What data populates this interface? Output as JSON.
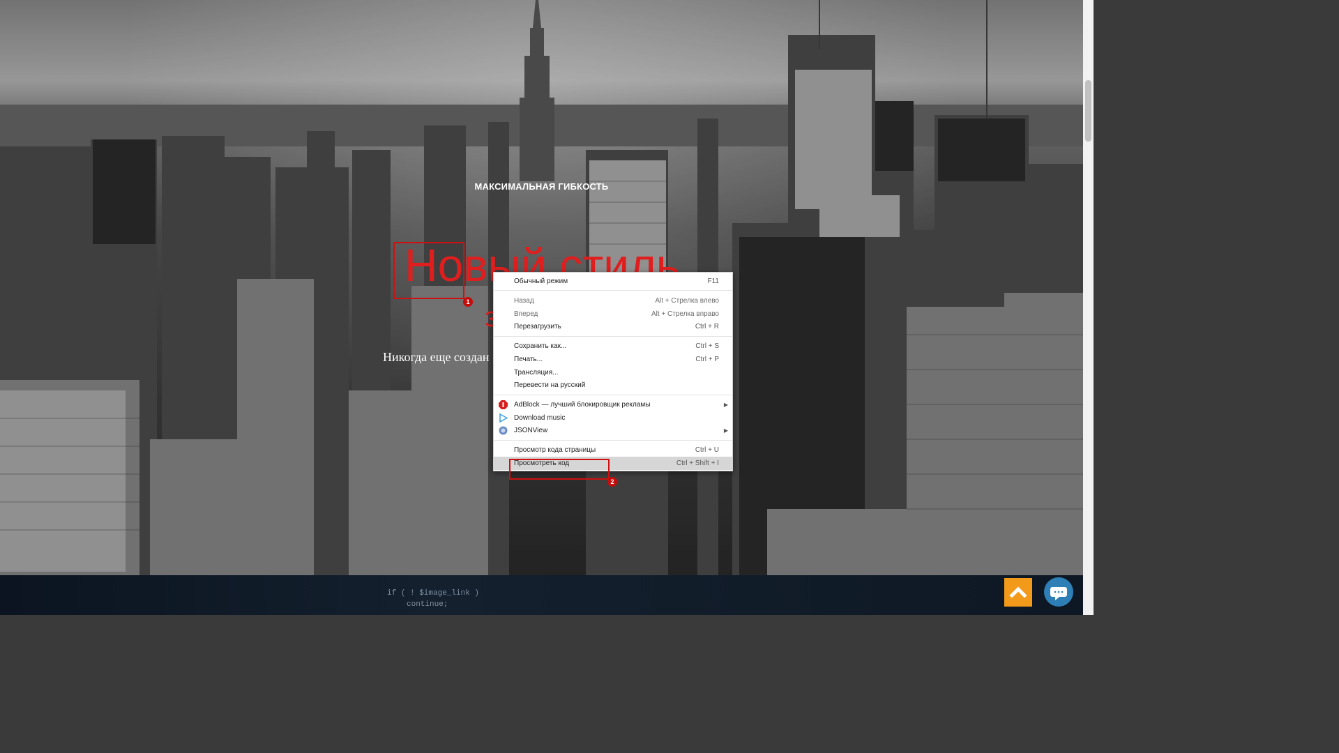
{
  "hero": {
    "kicker": "МАКСИМАЛЬНАЯ ГИБКОСТЬ",
    "headline": "Новый стиль",
    "headline_second": "з",
    "subtext": "Никогда еще создан"
  },
  "context_menu": {
    "normal_mode": {
      "label": "Обычный режим",
      "shortcut": "F11"
    },
    "back": {
      "label": "Назад",
      "shortcut": "Alt + Стрелка влево"
    },
    "forward": {
      "label": "Вперед",
      "shortcut": "Alt + Стрелка вправо"
    },
    "reload": {
      "label": "Перезагрузить",
      "shortcut": "Ctrl + R"
    },
    "save_as": {
      "label": "Сохранить как...",
      "shortcut": "Ctrl + S"
    },
    "print": {
      "label": "Печать...",
      "shortcut": "Ctrl + P"
    },
    "cast": {
      "label": "Трансляция..."
    },
    "translate": {
      "label": "Перевести на русский"
    },
    "adblock": {
      "label": "AdBlock — лучший блокировщик рекламы"
    },
    "download_music": {
      "label": "Download music"
    },
    "jsonview": {
      "label": "JSONView"
    },
    "view_source": {
      "label": "Просмотр кода страницы",
      "shortcut": "Ctrl + U"
    },
    "inspect": {
      "label": "Просмотреть код",
      "shortcut": "Ctrl + Shift + I"
    }
  },
  "annotations": {
    "badge_1": "1",
    "badge_2": "2"
  },
  "code_strip": {
    "line1": "if ( ! $image_link )",
    "line2": "continue;"
  },
  "colors": {
    "headline": "#e01e1e",
    "annotation": "#d01010",
    "up_button": "#f39a1a",
    "chat_button": "#2e7fb5",
    "menu_hover": "#d6d6d6"
  },
  "icons": {
    "adblock": "adblock-icon",
    "download_music": "play-icon",
    "jsonview": "jsonview-icon",
    "submenu": "chevron-right-icon",
    "up": "arrow-up-icon",
    "chat": "chat-bubble-icon"
  }
}
